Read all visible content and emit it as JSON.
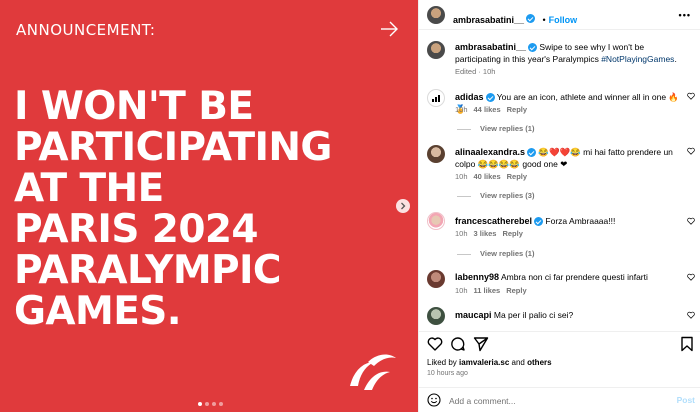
{
  "post": {
    "announcement": "ANNOUNCEMENT:",
    "headline_lines": [
      "I WON'T BE",
      "PARTICIPATING",
      "AT THE",
      "PARIS 2024",
      "PARALYMPIC",
      "GAMES."
    ],
    "carousel": {
      "total": 4,
      "active_index": 0
    }
  },
  "header": {
    "username": "ambrasabatini__",
    "follow_label": "Follow",
    "more_label": "•••"
  },
  "caption": {
    "username": "ambrasabatini__",
    "text": "Swipe to see why I won't be participating in this year's Paralympics",
    "hashtag": "#NotPlayingGames",
    "hashtag_suffix": ".",
    "meta": "Edited · 10h"
  },
  "comments": [
    {
      "username": "adidas",
      "verified": true,
      "text": "You are an icon, athlete and winner all in one 🔥🏅",
      "time": "10h",
      "likes": "44 likes",
      "reply": "Reply",
      "view_replies": "View replies (1)"
    },
    {
      "username": "alinaalexandra.s",
      "verified": true,
      "text": "😂❤️❤️😂 mi hai fatto prendere un colpo 😂😂😂😂 good one ❤",
      "time": "10h",
      "likes": "40 likes",
      "reply": "Reply",
      "view_replies": "View replies (3)"
    },
    {
      "username": "francescatherebel",
      "verified": true,
      "text": "Forza Ambraaaa!!!",
      "time": "10h",
      "likes": "3 likes",
      "reply": "Reply",
      "view_replies": "View replies (1)"
    },
    {
      "username": "labenny98",
      "verified": false,
      "text": "Ambra non ci far prendere questi infarti",
      "time": "10h",
      "likes": "11 likes",
      "reply": "Reply",
      "view_replies": ""
    },
    {
      "username": "maucapi",
      "verified": false,
      "text": "Ma per il palio ci sei?",
      "time": "",
      "likes": "",
      "reply": "",
      "view_replies": ""
    }
  ],
  "footer": {
    "liked_by_prefix": "Liked by",
    "liked_by_user": "iamvaleria.sc",
    "liked_by_and": "and",
    "liked_by_others": "others",
    "time_ago": "10 hours ago",
    "add_comment_placeholder": "Add a comment...",
    "post_label": "Post"
  },
  "colors": {
    "post_bg": "#e03a3c",
    "link": "#0095f6",
    "verified": "#1d9bf0"
  }
}
